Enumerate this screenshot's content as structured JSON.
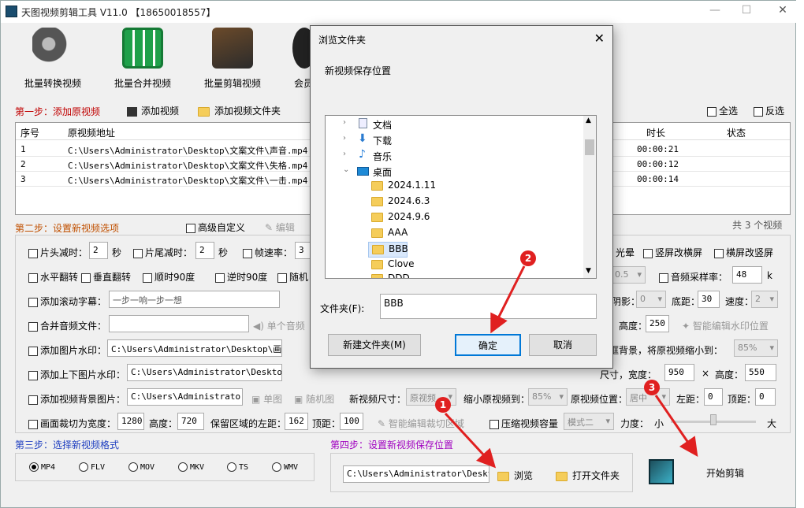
{
  "app": {
    "title": "天图视频剪辑工具 V11.0  【18650018557】",
    "minimize": "—",
    "maximize": "☐",
    "close": "✕"
  },
  "toolbar": [
    {
      "label": "批量转换视频",
      "icon": "convert-reel-icon"
    },
    {
      "label": "批量合并视频",
      "icon": "merge-film-icon"
    },
    {
      "label": "批量剪辑视频",
      "icon": "scissors-film-icon"
    },
    {
      "label": "会员",
      "icon": "member-icon"
    }
  ],
  "step1": {
    "label": "第一步：添加原视频",
    "add_video": "添加视频",
    "add_folder": "添加视频文件夹",
    "select_all": "全选",
    "invert": "反选"
  },
  "table": {
    "headers": {
      "index": "序号",
      "path": "原视频地址",
      "duration": "时长",
      "status": "状态"
    },
    "rows": [
      {
        "index": "1",
        "path": "C:\\Users\\Administrator\\Desktop\\文案文件\\声音.mp4",
        "duration": "00:00:21"
      },
      {
        "index": "2",
        "path": "C:\\Users\\Administrator\\Desktop\\文案文件\\失格.mp4",
        "duration": "00:00:12"
      },
      {
        "index": "3",
        "path": "C:\\Users\\Administrator\\Desktop\\文案文件\\一击.mp4",
        "duration": "00:00:14"
      }
    ],
    "count": "共 3 个视频"
  },
  "step2": {
    "label": "第二步：设置新视频选项",
    "advanced": "高级自定义",
    "edit": "编辑",
    "head_trim": "片头减时：",
    "head_val": "2",
    "sec": "秒",
    "tail_trim": "片尾减时：",
    "tail_val": "2",
    "frame_rate": "帧速率：",
    "frame_val": "3",
    "halo": "光晕",
    "vert_to_horiz": "竖屏改横屏",
    "horiz_to_vert": "横屏改竖屏",
    "hflip": "水平翻转",
    "vflip": "垂直翻转",
    "rot90": "顺时90度",
    "rot90ccw": "逆时90度",
    "random": "随机",
    "val_0_5": "0.5",
    "audio_rate": "音频采样率：",
    "audio_val": "48",
    "k": "k",
    "scroll_sub": "添加滚动字幕：",
    "scroll_text": "一步一响一步一想",
    "shadow": "阴影：",
    "shadow_val": "0",
    "bottom": "底距：",
    "bottom_val": "30",
    "speed": "速度：",
    "speed_val": "2",
    "merge_audio": "合并音频文件：",
    "single_audio": "单个音频",
    "height_lbl": "高度：",
    "height_val": "250",
    "smart_watermark": "智能编辑水印位置",
    "img_watermark": "添加图片水印：",
    "img_watermark_path": "C:\\Users\\Administrator\\Desktop\\画中画",
    "border_bg": "边框背景，将原视频缩小到：",
    "border_pct": "85%",
    "topbottom_img": "添加上下图片水印：",
    "topbottom_path": "C:\\Users\\Administrator\\Desktop\\A",
    "size_lbl": "尺寸，宽度：",
    "width_val": "950",
    "times": "×",
    "height2_lbl": "高度：",
    "height2_val": "550",
    "bg_img": "添加视频背景图片：",
    "bg_path": "C:\\Users\\Administrator\\Desktop\\D",
    "single_img": "单图",
    "random_img": "随机图",
    "new_size": "新视频尺寸：",
    "orig_video": "原视频",
    "shrink": "缩小原视频到：",
    "shrink_pct": "85%",
    "position": "原视频位置：",
    "center": "居中",
    "left_dist": "左距：",
    "left_val": "0",
    "top_dist": "顶距：",
    "top_val": "0",
    "crop": "画面裁切为宽度：",
    "crop_w": "1280",
    "crop_h_lbl": "高度：",
    "crop_h": "720",
    "keep_left": "保留区域的左距：",
    "keep_left_val": "162",
    "crop_top_lbl": "顶距：",
    "crop_top": "100",
    "smart_crop": "智能编辑裁切区域",
    "compress": "压缩视频容量",
    "mode": "模式二",
    "strength": "力度：",
    "small": "小",
    "large": "大"
  },
  "step3": {
    "label": "第三步：选择新视频格式",
    "formats": [
      "MP4",
      "FLV",
      "MOV",
      "MKV",
      "TS",
      "WMV"
    ]
  },
  "step4": {
    "label": "第四步：设置新视频保存位置",
    "path": "C:\\Users\\Administrator\\Desktop",
    "browse": "浏览",
    "open_folder": "打开文件夹",
    "start": "开始剪辑"
  },
  "dialog": {
    "title": "浏览文件夹",
    "prompt": "新视频保存位置",
    "tree": [
      {
        "label": "文档",
        "arrow": "›"
      },
      {
        "label": "下载",
        "arrow": "›"
      },
      {
        "label": "音乐",
        "arrow": "›"
      },
      {
        "label": "桌面",
        "arrow": "⌄"
      },
      {
        "label": "2024.1.11"
      },
      {
        "label": "2024.6.3"
      },
      {
        "label": "2024.9.6"
      },
      {
        "label": "AAA"
      },
      {
        "label": "BBB"
      },
      {
        "label": "Clove"
      },
      {
        "label": "DDD"
      }
    ],
    "folder_label": "文件夹(F):",
    "folder_value": "BBB",
    "new_folder": "新建文件夹(M)",
    "ok": "确定",
    "cancel": "取消"
  },
  "badges": [
    "1",
    "2",
    "3"
  ],
  "colors": {
    "red": "#c00000",
    "blue": "#1f3fc0",
    "purple": "#a000c0",
    "badge": "#e02020"
  }
}
